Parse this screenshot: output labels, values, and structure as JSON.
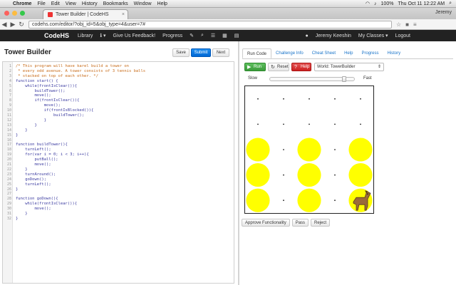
{
  "menubar": {
    "apple": "",
    "items": [
      "Chrome",
      "File",
      "Edit",
      "View",
      "History",
      "Bookmarks",
      "Window",
      "Help"
    ],
    "status": {
      "battery": "100%",
      "clock": "Thu Oct 11  12:22 AM"
    }
  },
  "browser": {
    "tab_title": "Tower Builder | CodeHS",
    "user": "Jeremy",
    "url": "codehs.com/editor/?obj_id=5&obj_type=4&user=7#"
  },
  "navbar": {
    "logo": "CodeHS",
    "links": [
      "Library",
      "Give Us Feedback!",
      "Progress"
    ],
    "user_name": "Jeremy Keeshin",
    "my_classes": "My Classes",
    "logout": "Logout"
  },
  "editor": {
    "title": "Tower Builder",
    "save_label": "Save",
    "submit_label": "Submit",
    "next_label": "Next",
    "lines": [
      {
        "text": "/* This program will have karel build a tower on",
        "type": "comment"
      },
      {
        "text": " * every odd avenue. A tower consists of 3 tennis balls",
        "type": "comment"
      },
      {
        "text": " * stacked on top of each other. */",
        "type": "comment"
      },
      {
        "text": "function start() {",
        "type": "code"
      },
      {
        "text": "    while(frontIsClear()){",
        "type": "code"
      },
      {
        "text": "        buildTower();",
        "type": "code"
      },
      {
        "text": "        move();",
        "type": "code"
      },
      {
        "text": "        if(frontIsClear()){",
        "type": "code"
      },
      {
        "text": "            move();",
        "type": "code"
      },
      {
        "text": "            if(frontIsBlocked()){",
        "type": "code"
      },
      {
        "text": "                buildTower();",
        "type": "code"
      },
      {
        "text": "            }",
        "type": "code"
      },
      {
        "text": "        }",
        "type": "code"
      },
      {
        "text": "    }",
        "type": "code"
      },
      {
        "text": "}",
        "type": "code"
      },
      {
        "text": "",
        "type": "code"
      },
      {
        "text": "function buildTower(){",
        "type": "code"
      },
      {
        "text": "    turnLeft();",
        "type": "code"
      },
      {
        "text": "    for(var i = 0; i < 3; i++){",
        "type": "code"
      },
      {
        "text": "        putBall();",
        "type": "code"
      },
      {
        "text": "        move();",
        "type": "code"
      },
      {
        "text": "    }",
        "type": "code"
      },
      {
        "text": "    turnAround();",
        "type": "code"
      },
      {
        "text": "    goDown();",
        "type": "code"
      },
      {
        "text": "    turnLeft();",
        "type": "code"
      },
      {
        "text": "}",
        "type": "code"
      },
      {
        "text": "",
        "type": "code"
      },
      {
        "text": "function goDown(){",
        "type": "code"
      },
      {
        "text": "    while(frontIsClear()){",
        "type": "code"
      },
      {
        "text": "        move();",
        "type": "code"
      },
      {
        "text": "    }",
        "type": "code"
      },
      {
        "text": "}",
        "type": "code"
      }
    ]
  },
  "runner": {
    "tabs": [
      "Run Code",
      "Challenge Info",
      "Cheat Sheet",
      "Help",
      "Progress",
      "History"
    ],
    "active_tab": 0,
    "run_label": "Run",
    "reset_label": "Reset",
    "help_label": "Help",
    "world_select": "World: TowerBuilder",
    "slow_label": "Slow",
    "fast_label": "Fast",
    "speed_fraction": 0.9,
    "approve_label": "Approve Functionality",
    "pass_label": "Pass",
    "reject_label": "Reject"
  },
  "world": {
    "cols": 5,
    "rows": 5,
    "balls": [
      [
        0,
        0
      ],
      [
        0,
        1
      ],
      [
        0,
        2
      ],
      [
        2,
        0
      ],
      [
        2,
        1
      ],
      [
        2,
        2
      ],
      [
        4,
        0
      ],
      [
        4,
        1
      ],
      [
        4,
        2
      ]
    ],
    "karel": [
      4,
      0
    ],
    "ball_color": "#ffff00"
  }
}
